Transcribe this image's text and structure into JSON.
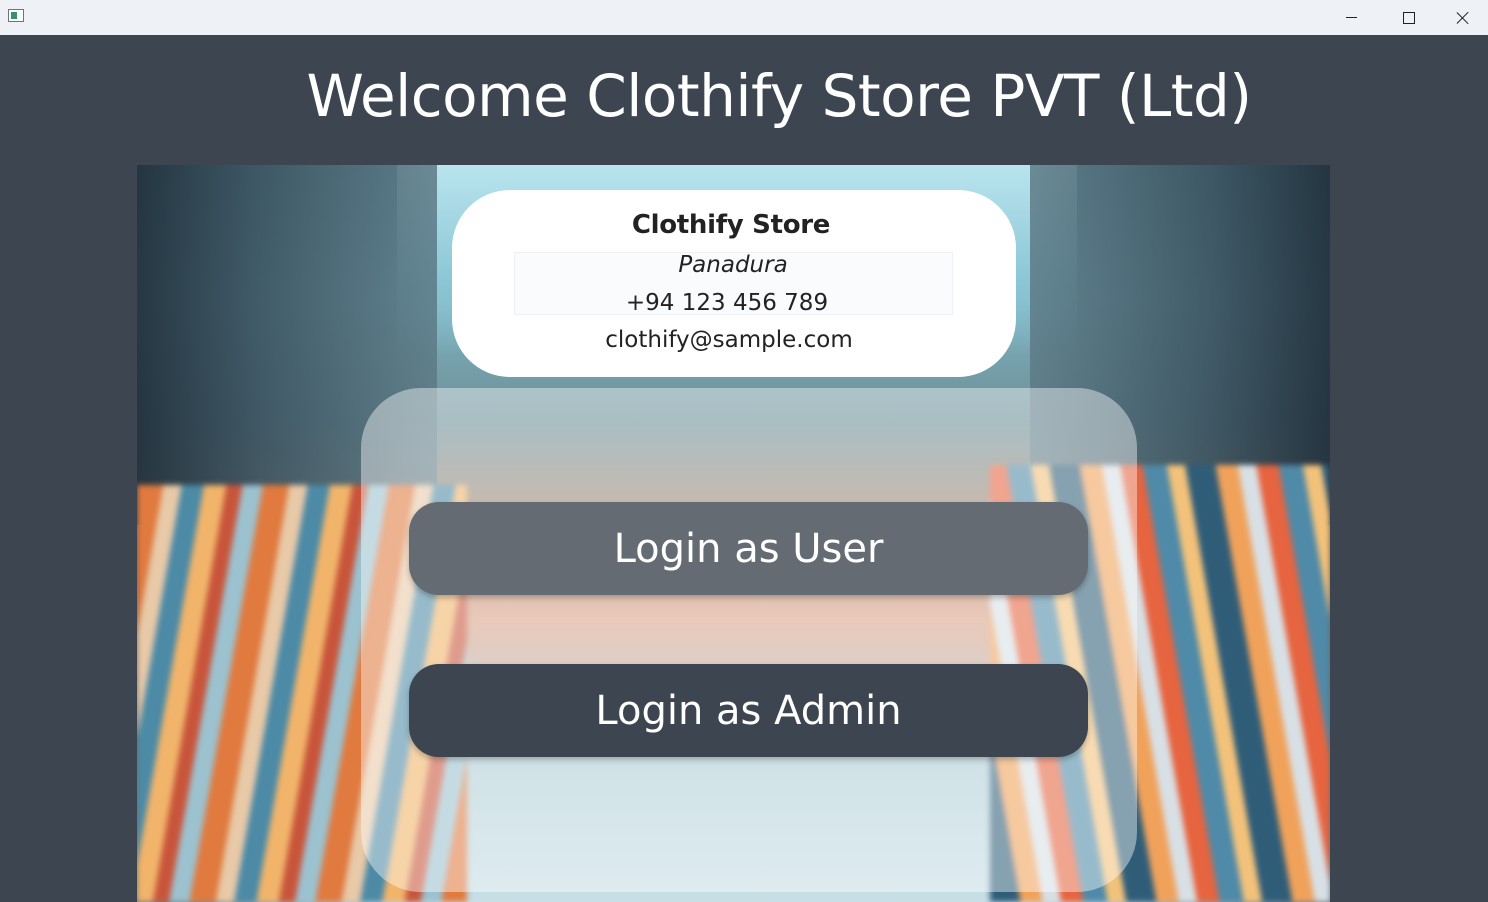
{
  "window": {
    "controls": {
      "minimize_icon": "minimize-icon",
      "maximize_icon": "maximize-icon",
      "close_icon": "close-icon"
    }
  },
  "header": {
    "title": "Welcome Clothify Store PVT (Ltd)"
  },
  "store_card": {
    "name": "Clothify Store",
    "location": "Panadura",
    "phone": "+94 123 456 789",
    "email": "clothify@sample.com"
  },
  "login": {
    "user_button_label": "Login as User",
    "admin_button_label": "Login as Admin"
  },
  "colors": {
    "background": "#3d4551",
    "user_button": "#646b73",
    "admin_button": "#3d4551",
    "card": "#ffffff"
  }
}
